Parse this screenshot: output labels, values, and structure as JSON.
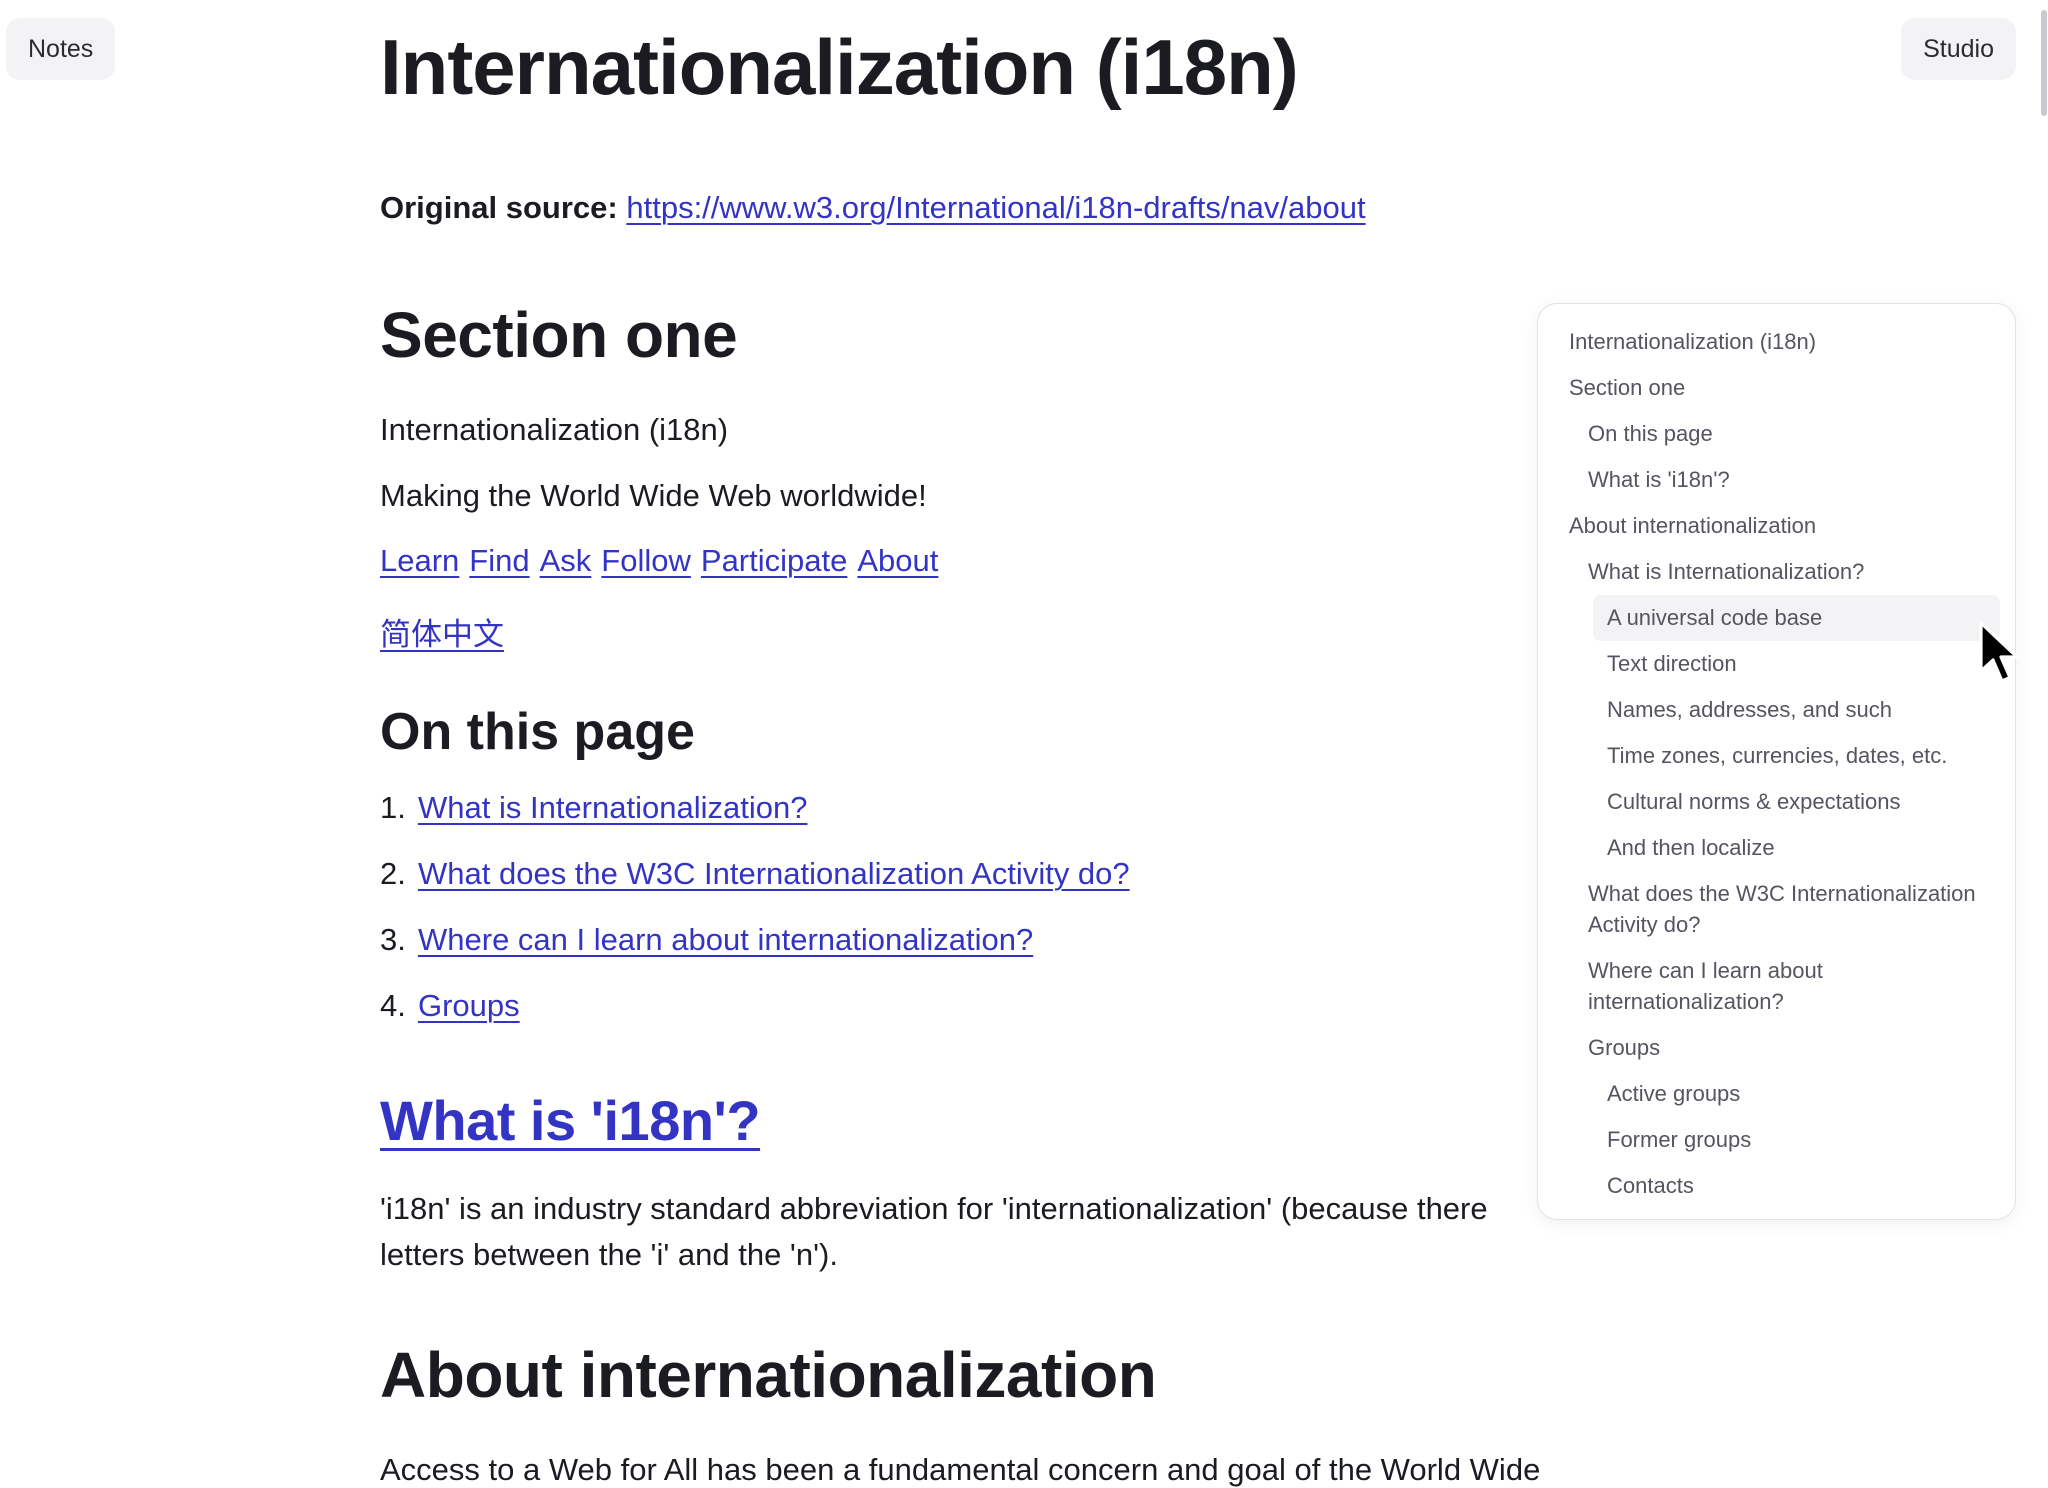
{
  "buttons": {
    "notes": "Notes",
    "studio": "Studio"
  },
  "article": {
    "title": "Internationalization (i18n)",
    "source_label": "Original source:",
    "source_url": "https://www.w3.org/International/i18n-drafts/nav/about",
    "section_one": {
      "heading": "Section one",
      "line1": "Internationalization (i18n)",
      "line2": "Making the World Wide Web worldwide!",
      "nav_links": [
        "Learn",
        "Find",
        "Ask",
        "Follow",
        "Participate",
        "About"
      ],
      "language_link": "简体中文"
    },
    "on_this_page": {
      "heading": "On this page",
      "items": [
        {
          "num": "1.",
          "label": "What is Internationalization?"
        },
        {
          "num": "2.",
          "label": "What does the W3C Internationalization Activity do?"
        },
        {
          "num": "3.",
          "label": "Where can I learn about internationalization?"
        },
        {
          "num": "4.",
          "label": "Groups"
        }
      ]
    },
    "what_is_i18n": {
      "heading": "What is 'i18n'?",
      "body": "'i18n' is an industry standard abbreviation for 'internationalization' (because there letters between the 'i' and the 'n')."
    },
    "about": {
      "heading": "About internationalization",
      "body": "Access to a Web for All has been a fundamental concern and goal of the World Wide"
    }
  },
  "outline": {
    "items": [
      {
        "label": "Internationalization (i18n)",
        "level": 1
      },
      {
        "label": "Section one",
        "level": 1
      },
      {
        "label": "On this page",
        "level": 2
      },
      {
        "label": "What is 'i18n'?",
        "level": 2
      },
      {
        "label": "About internationalization",
        "level": 1
      },
      {
        "label": "What is Internationalization?",
        "level": 2
      },
      {
        "label": "A universal code base",
        "level": 3,
        "hovered": true
      },
      {
        "label": "Text direction",
        "level": 3
      },
      {
        "label": "Names, addresses, and such",
        "level": 3
      },
      {
        "label": "Time zones, currencies, dates, etc.",
        "level": 3
      },
      {
        "label": "Cultural norms & expectations",
        "level": 3
      },
      {
        "label": "And then localize",
        "level": 3
      },
      {
        "label": "What does the W3C Internationalization Activity do?",
        "level": 2
      },
      {
        "label": "Where can I learn about internationalization?",
        "level": 2
      },
      {
        "label": "Groups",
        "level": 2
      },
      {
        "label": "Active groups",
        "level": 3
      },
      {
        "label": "Former groups",
        "level": 3
      },
      {
        "label": "Contacts",
        "level": 3
      }
    ]
  },
  "colors": {
    "link": "#3434c4",
    "text": "#1b1b22",
    "outline_text": "#55555f",
    "button_bg": "#f3f3f5"
  }
}
